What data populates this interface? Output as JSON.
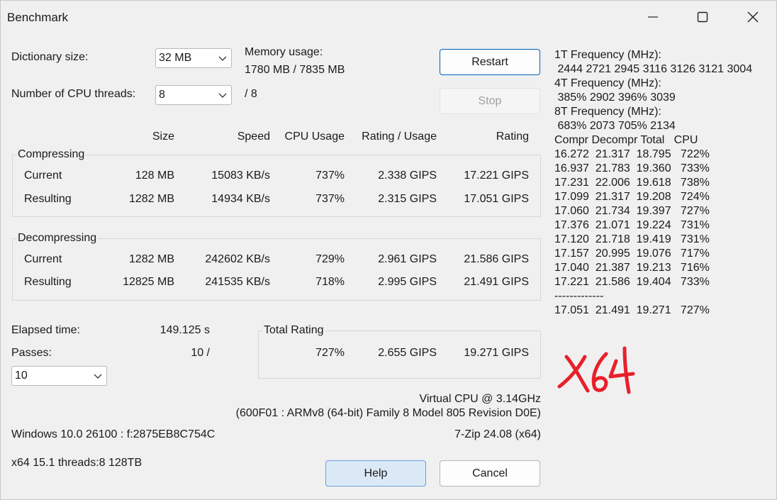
{
  "window": {
    "title": "Benchmark"
  },
  "settings": {
    "dict_label": "Dictionary size:",
    "dict_value": "32 MB",
    "threads_label": "Number of CPU threads:",
    "threads_value": "8",
    "threads_max": "/ 8",
    "memory_label": "Memory usage:",
    "memory_value": "1780 MB / 7835 MB"
  },
  "buttons": {
    "restart": "Restart",
    "stop": "Stop",
    "help": "Help",
    "cancel": "Cancel"
  },
  "headers": {
    "size": "Size",
    "speed": "Speed",
    "cpu": "CPU Usage",
    "rating_usage": "Rating / Usage",
    "rating": "Rating"
  },
  "compressing": {
    "label": "Compressing",
    "rows": [
      {
        "label": "Current",
        "size": "128 MB",
        "speed": "15083 KB/s",
        "cpu": "737%",
        "ru": "2.338 GIPS",
        "rating": "17.221 GIPS"
      },
      {
        "label": "Resulting",
        "size": "1282 MB",
        "speed": "14934 KB/s",
        "cpu": "737%",
        "ru": "2.315 GIPS",
        "rating": "17.051 GIPS"
      }
    ]
  },
  "decompressing": {
    "label": "Decompressing",
    "rows": [
      {
        "label": "Current",
        "size": "1282 MB",
        "speed": "242602 KB/s",
        "cpu": "729%",
        "ru": "2.961 GIPS",
        "rating": "21.586 GIPS"
      },
      {
        "label": "Resulting",
        "size": "12825 MB",
        "speed": "241535 KB/s",
        "cpu": "718%",
        "ru": "2.995 GIPS",
        "rating": "21.491 GIPS"
      }
    ]
  },
  "elapsed": {
    "label": "Elapsed time:",
    "value": "149.125 s"
  },
  "passes": {
    "label": "Passes:",
    "value": "10 /",
    "select": "10"
  },
  "total": {
    "label": "Total Rating",
    "cpu": "727%",
    "ru": "2.655 GIPS",
    "rating": "19.271 GIPS"
  },
  "cpu_info": {
    "line1": "Virtual CPU @ 3.14GHz",
    "line2": "(600F01 : ARMv8 (64-bit) Family 8 Model 805 Revision D0E)"
  },
  "system": {
    "os": "Windows 10.0 26100 :  f:2875EB8C754C",
    "version": "7-Zip 24.08 (x64)",
    "build": "x64 15.1 threads:8 128TB"
  },
  "log": {
    "lines": [
      "1T Frequency (MHz):",
      " 2444 2721 2945 3116 3126 3121 3004",
      "4T Frequency (MHz):",
      " 385% 2902 396% 3039",
      "8T Frequency (MHz):",
      " 683% 2073 705% 2134",
      "Compr Decompr Total   CPU",
      "16.272  21.317  18.795   722%",
      "16.937  21.783  19.360   733%",
      "17.231  22.006  19.618   738%",
      "17.099  21.317  19.208   724%",
      "17.060  21.734  19.397   727%",
      "17.376  21.071  19.224   731%",
      "17.120  21.718  19.419   731%",
      "17.157  20.995  19.076   717%",
      "17.040  21.387  19.213   716%",
      "17.221  21.586  19.404   733%",
      "-------------",
      "17.051  21.491  19.271   727%"
    ]
  },
  "annotation": {
    "text": "x64",
    "color": "#e8202a"
  }
}
